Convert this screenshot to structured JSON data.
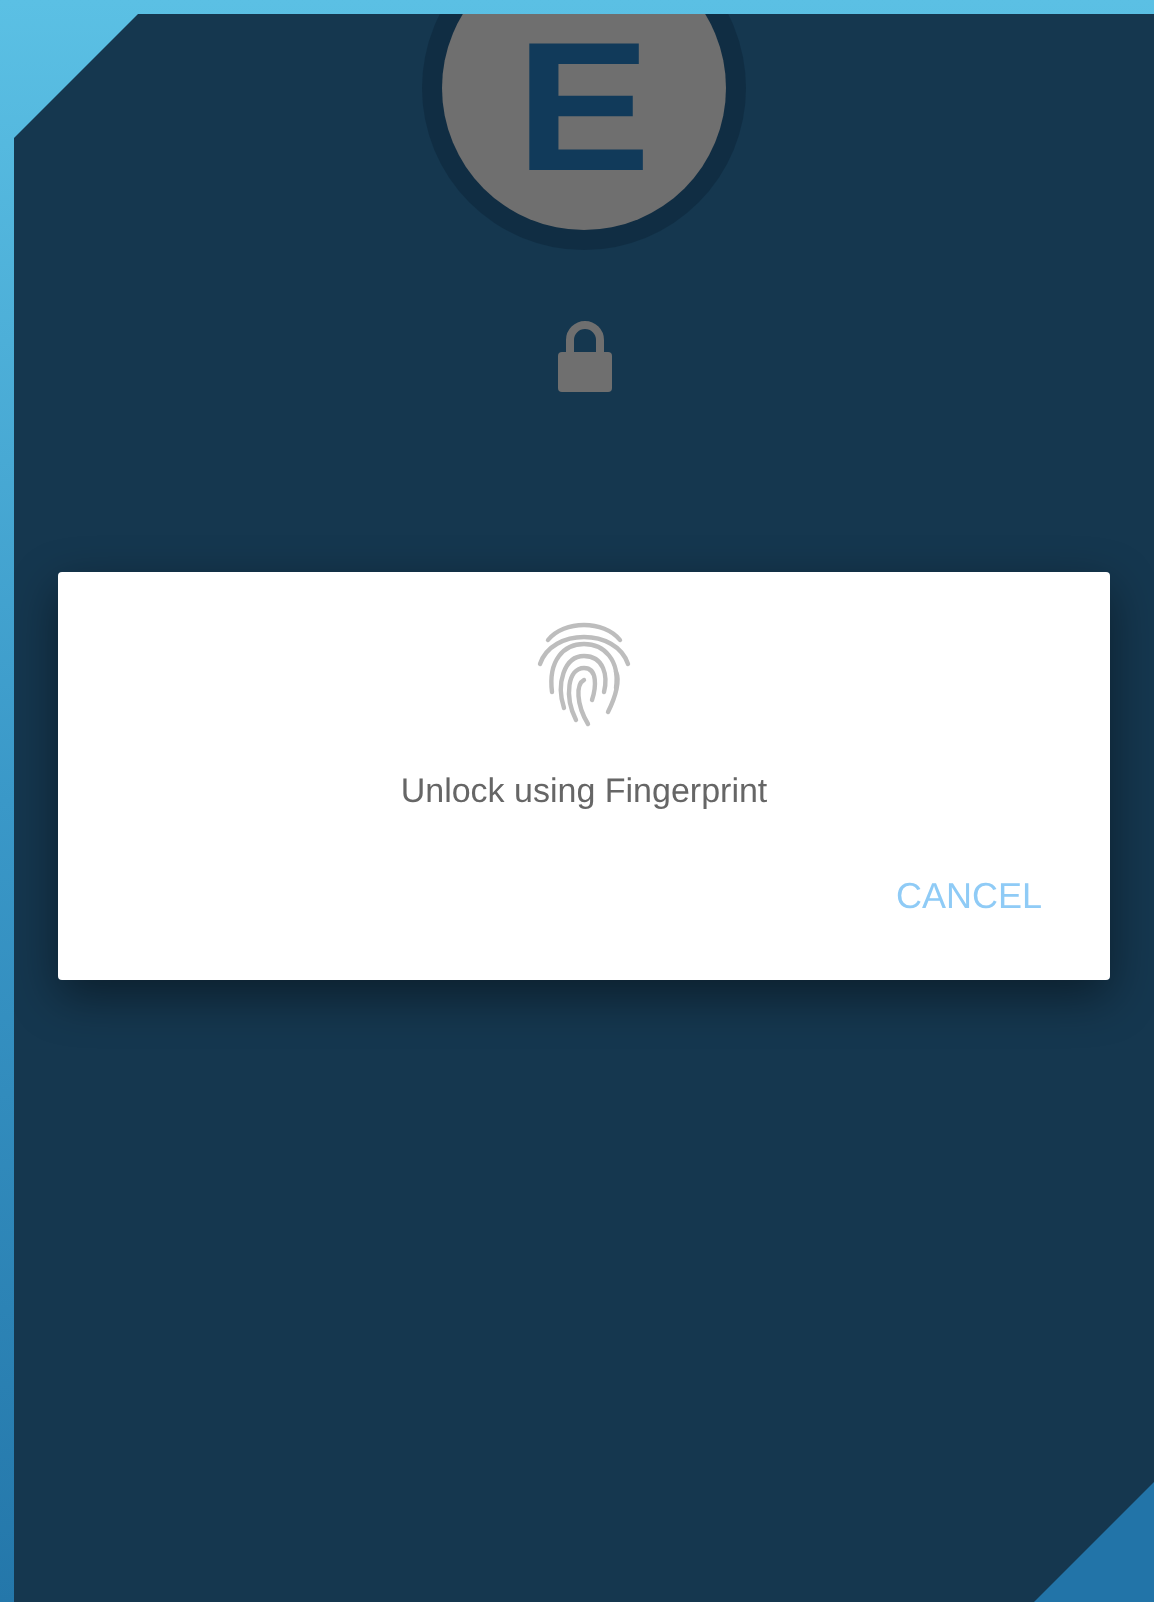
{
  "logo": {
    "letter": "E"
  },
  "dialog": {
    "message": "Unlock using Fingerprint",
    "buttons": [
      "CANCEL"
    ]
  }
}
